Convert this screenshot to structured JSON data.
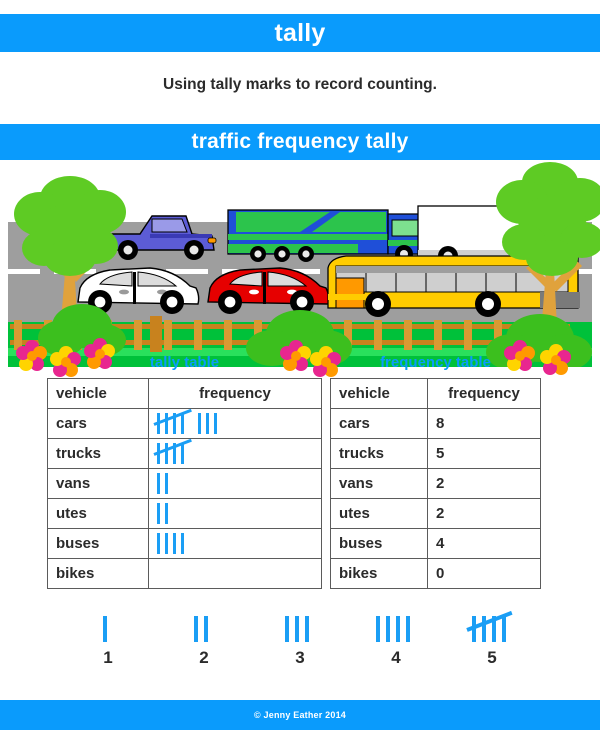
{
  "header": {
    "title": "tally",
    "subtitle": "Using tally marks to record counting.",
    "section_title": "traffic frequency tally"
  },
  "footer": {
    "copyright": "© Jenny Eather 2014"
  },
  "colors": {
    "accent_blue": "#0a9bfc",
    "tally_blue": "#1a9ef5",
    "text_dark": "#2b2b2b",
    "table_border": "#5b5b5b",
    "road_gray": "#9e9e9e",
    "grass_green": "#00c13a",
    "tree_green": "#5ecb24"
  },
  "tally_table": {
    "caption": "tally table",
    "columns": [
      "vehicle",
      "frequency"
    ],
    "rows": [
      {
        "vehicle": "cars",
        "count": 8
      },
      {
        "vehicle": "trucks",
        "count": 5
      },
      {
        "vehicle": "vans",
        "count": 2
      },
      {
        "vehicle": "utes",
        "count": 2
      },
      {
        "vehicle": "buses",
        "count": 4
      },
      {
        "vehicle": "bikes",
        "count": 0
      }
    ]
  },
  "frequency_table": {
    "caption": "frequency table",
    "columns": [
      "vehicle",
      "frequency"
    ],
    "rows": [
      {
        "vehicle": "cars",
        "frequency": "8"
      },
      {
        "vehicle": "trucks",
        "frequency": "5"
      },
      {
        "vehicle": "vans",
        "frequency": "2"
      },
      {
        "vehicle": "utes",
        "frequency": "2"
      },
      {
        "vehicle": "buses",
        "frequency": "4"
      },
      {
        "vehicle": "bikes",
        "frequency": "0"
      }
    ]
  },
  "legend": {
    "items": [
      {
        "count": 1,
        "label": "1"
      },
      {
        "count": 2,
        "label": "2"
      },
      {
        "count": 3,
        "label": "3"
      },
      {
        "count": 4,
        "label": "4"
      },
      {
        "count": 5,
        "label": "5"
      }
    ]
  },
  "illustration": {
    "name": "road-traffic-scene",
    "vehicles": [
      {
        "type": "ute",
        "color": "#5c5cd6"
      },
      {
        "type": "truck",
        "color": "#1f4fd8"
      },
      {
        "type": "van",
        "color": "#ffffff"
      },
      {
        "type": "car",
        "color": "#ffffff"
      },
      {
        "type": "car",
        "color": "#e60000"
      },
      {
        "type": "bus",
        "color": "#ffcc00"
      }
    ],
    "scenery": [
      "tree",
      "tree",
      "bush",
      "fence",
      "flowers",
      "grass",
      "road"
    ]
  }
}
